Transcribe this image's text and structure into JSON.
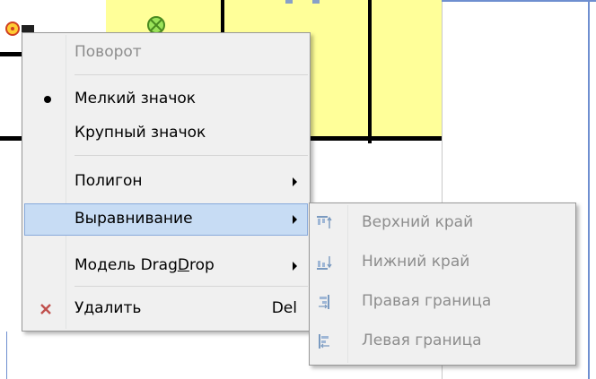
{
  "colors": {
    "canvas_yellow": "#ffff99",
    "wall": "#000000",
    "highlight_fill": "#c7dcf4",
    "highlight_border": "#87a9db",
    "delete_x": "#c0504d",
    "disabled_text": "#8d8d8d"
  },
  "context_menu": {
    "items": [
      {
        "label": "Поворот",
        "disabled": true
      },
      {
        "label": "Мелкий значок",
        "checked": true,
        "glyph": "bullet-icon"
      },
      {
        "label": "Крупный значок"
      },
      {
        "label": "Полигон",
        "submenu": true
      },
      {
        "label": "Выравнивание",
        "submenu": true,
        "highlighted": true
      },
      {
        "label_prefix": "Модель Drag",
        "label_mnemonic": "D",
        "label_suffix": "rop",
        "submenu": true
      },
      {
        "label": "Удалить",
        "shortcut": "Del",
        "glyph": "delete-x-icon"
      }
    ]
  },
  "align_submenu": {
    "items": [
      {
        "label": "Верхний край",
        "disabled": true,
        "icon": "align-top-icon"
      },
      {
        "label": "Нижний край",
        "disabled": true,
        "icon": "align-bottom-icon"
      },
      {
        "label": "Правая граница",
        "disabled": true,
        "icon": "align-right-icon"
      },
      {
        "label": "Левая граница",
        "disabled": true,
        "icon": "align-left-icon"
      }
    ]
  }
}
